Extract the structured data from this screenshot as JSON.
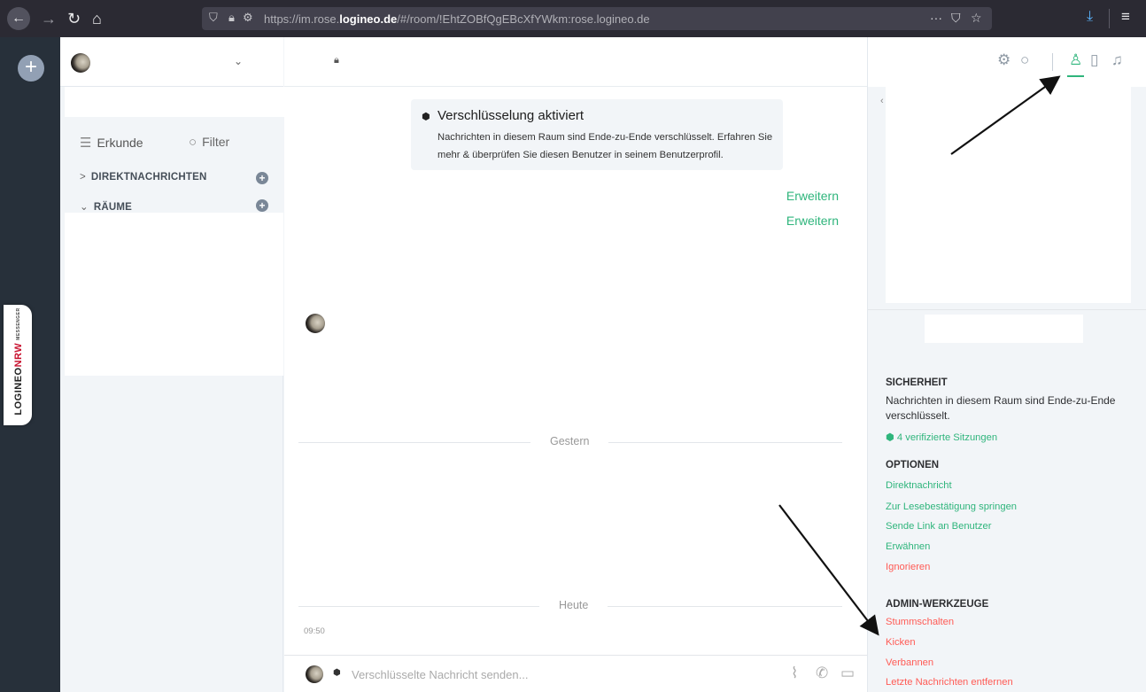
{
  "browser": {
    "url_prefix": "https://im.rose.",
    "url_domain": "logineo.de",
    "url_rest": "/#/room/!EhtZOBfQgEBcXfYWkm:rose.logineo.de",
    "icons": {
      "back": "arrow-left-icon",
      "forward": "arrow-right-icon",
      "reload": "reload-icon",
      "home": "home-icon",
      "shield": "shield-icon",
      "lock": "lock-icon",
      "permissions": "permissions-icon",
      "more": "more-icon",
      "pocket": "pocket-icon",
      "bookmark": "star-icon",
      "download": "download-icon",
      "menu": "hamburger-icon"
    }
  },
  "brand": {
    "logineo": "LOGINEO",
    "nrw": "NRW",
    "messenger": "MESSENGER"
  },
  "roomlist": {
    "explore": "Erkunde",
    "filter": "Filter",
    "sections": [
      {
        "label": "DIREKTNACHRICHTEN",
        "arrow": ">"
      },
      {
        "label": "RÄUME",
        "arrow": "⌄"
      }
    ]
  },
  "room": {
    "encryption_title": "Verschlüsselung aktiviert",
    "encryption_body": "Nachrichten in diesem Raum sind Ende-zu-Ende verschlüsselt. Erfahren Sie mehr & überprüfen Sie diesen Benutzer in seinem Benutzerprofil.",
    "expand_1": "Erweitern",
    "expand_2": "Erweitern",
    "divider_yesterday": "Gestern",
    "divider_today": "Heute",
    "timestamp": "09:50",
    "composer_placeholder": "Verschlüsselte Nachricht senden..."
  },
  "rightpanel": {
    "security_header": "SICHERHEIT",
    "security_text": "Nachrichten in diesem Raum sind Ende-zu-Ende verschlüsselt.",
    "verified_sessions": "4 verifizierte Sitzungen",
    "options_header": "OPTIONEN",
    "options": [
      {
        "label": "Direktnachricht",
        "color": "green"
      },
      {
        "label": "Zur Lesebestätigung springen",
        "color": "green"
      },
      {
        "label": "Sende Link an Benutzer",
        "color": "green"
      },
      {
        "label": "Erwähnen",
        "color": "green"
      },
      {
        "label": "Ignorieren",
        "color": "red"
      }
    ],
    "admin_header": "ADMIN-WERKZEUGE",
    "admin": [
      {
        "label": "Stummschalten"
      },
      {
        "label": "Kicken"
      },
      {
        "label": "Verbannen"
      },
      {
        "label": "Letzte Nachrichten entfernen"
      }
    ]
  },
  "colors": {
    "accent_green": "#2fb57c",
    "danger_red": "#ff5b55",
    "rail": "#27303a",
    "chrome": "#2b2a33"
  }
}
